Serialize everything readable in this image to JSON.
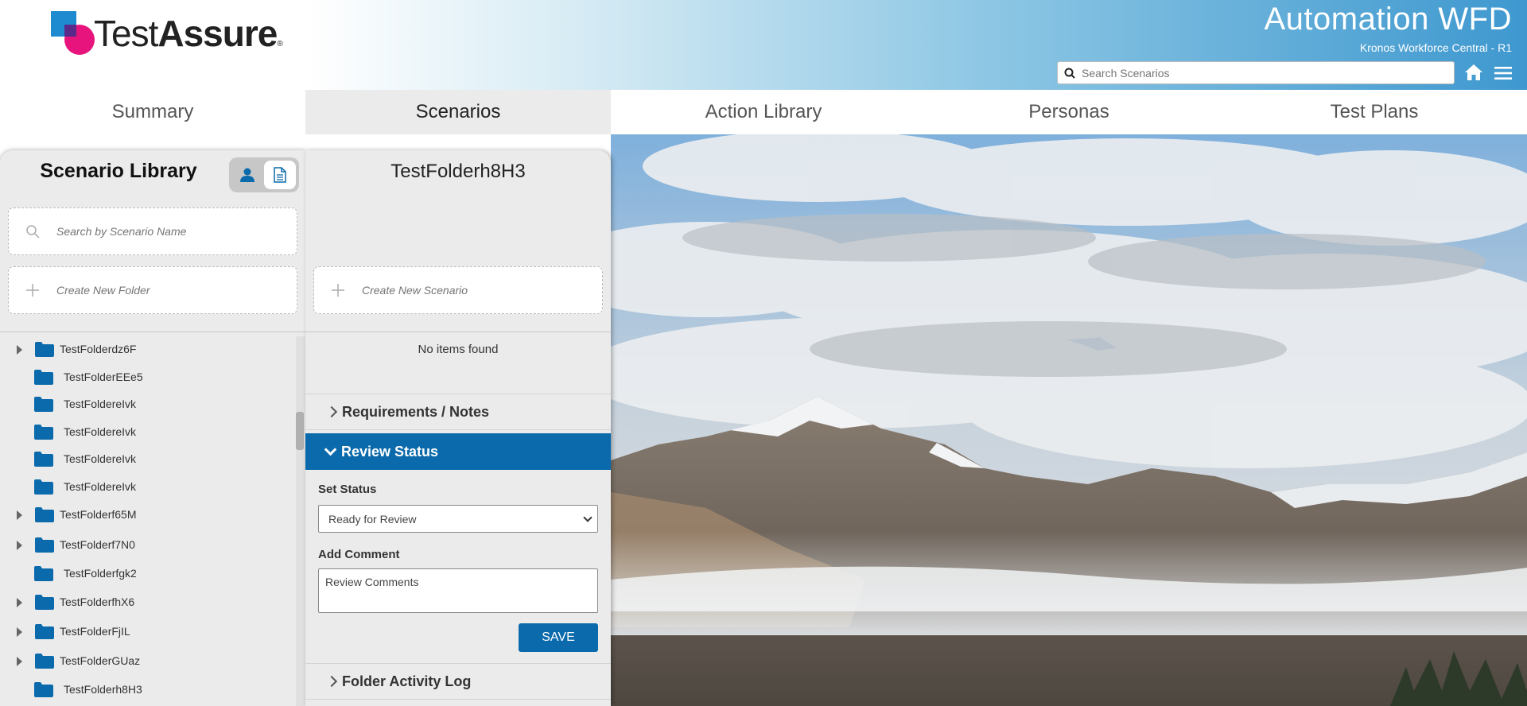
{
  "header": {
    "brand_prefix": "Test",
    "brand_suffix": "Assure",
    "brand_reg": "®",
    "app_title": "Automation WFD",
    "app_subtitle": "Kronos Workforce Central - R1",
    "search_placeholder": "Search Scenarios"
  },
  "nav": {
    "tabs": [
      {
        "label": "Summary"
      },
      {
        "label": "Scenarios"
      },
      {
        "label": "Action Library"
      },
      {
        "label": "Personas"
      },
      {
        "label": "Test Plans"
      }
    ],
    "active_index": 1
  },
  "library": {
    "title": "Scenario Library",
    "search_placeholder": "Search by Scenario Name",
    "create_folder_placeholder": "Create New Folder",
    "folders": [
      {
        "label": "TestFolderdz6F",
        "expandable": true
      },
      {
        "label": "TestFolderEEe5",
        "expandable": false
      },
      {
        "label": "TestFoldereIvk",
        "expandable": false
      },
      {
        "label": "TestFoldereIvk",
        "expandable": false
      },
      {
        "label": "TestFoldereIvk",
        "expandable": false
      },
      {
        "label": "TestFoldereIvk",
        "expandable": false
      },
      {
        "label": "TestFolderf65M",
        "expandable": true
      },
      {
        "label": "TestFolderf7N0",
        "expandable": true
      },
      {
        "label": "TestFolderfgk2",
        "expandable": false
      },
      {
        "label": "TestFolderfhX6",
        "expandable": true
      },
      {
        "label": "TestFolderFjIL",
        "expandable": true
      },
      {
        "label": "TestFolderGUaz",
        "expandable": true
      },
      {
        "label": "TestFolderh8H3",
        "expandable": false
      }
    ]
  },
  "folder": {
    "title": "TestFolderh8H3",
    "create_scenario_placeholder": "Create New Scenario",
    "empty_text": "No items found",
    "sections": {
      "requirements": "Requirements / Notes",
      "review": "Review Status",
      "activity": "Folder Activity Log"
    },
    "review": {
      "set_status_label": "Set Status",
      "status_value": "Ready for Review",
      "add_comment_label": "Add Comment",
      "comment_value": "Review Comments",
      "save_label": "SAVE"
    }
  },
  "colors": {
    "primary": "#0b6aab",
    "panel_bg": "#ebebeb",
    "folder_icon": "#0b6aab",
    "logo_blue": "#1e8bd0",
    "logo_pink": "#e6147c"
  }
}
